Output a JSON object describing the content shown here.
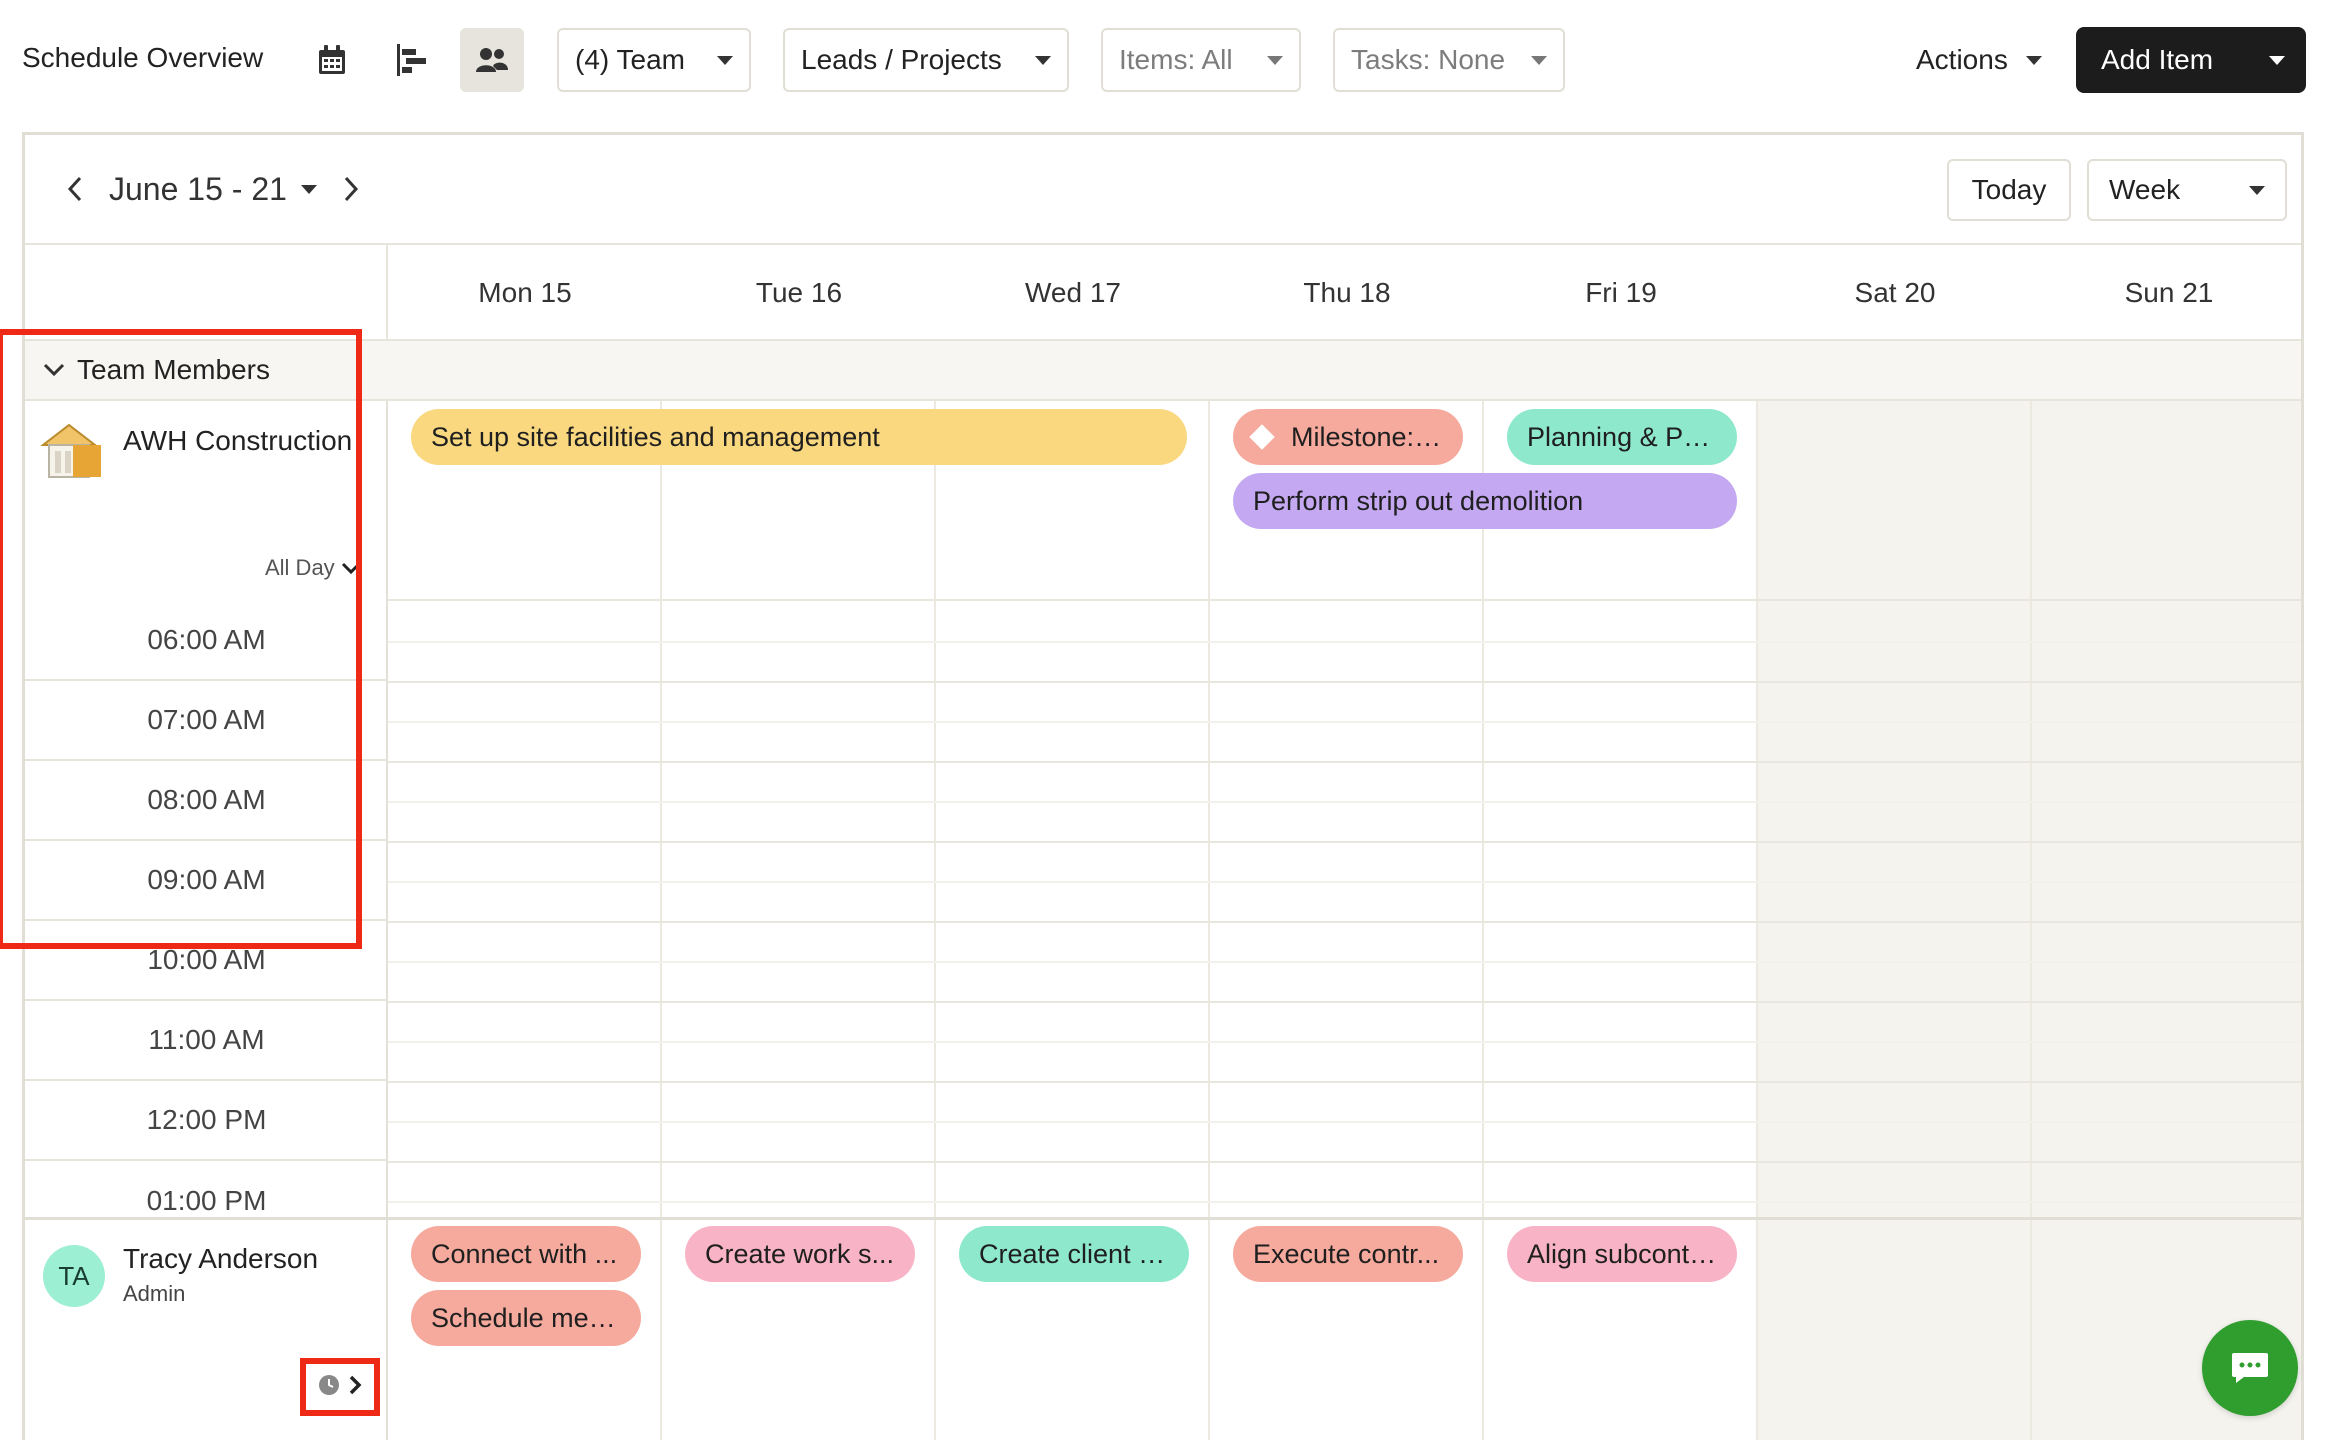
{
  "toolbar": {
    "title": "Schedule Overview",
    "team_filter": "(4) Team",
    "leads_filter": "Leads / Projects",
    "items_filter": "Items: All",
    "tasks_filter": "Tasks: None",
    "actions_label": "Actions",
    "add_item_label": "Add Item"
  },
  "calendar": {
    "range_label": "June 15 - 21",
    "today_label": "Today",
    "view_label": "Week",
    "days": [
      "Mon 15",
      "Tue 16",
      "Wed 17",
      "Thu 18",
      "Fri 19",
      "Sat 20",
      "Sun 21"
    ],
    "group_label": "Team Members"
  },
  "resources": [
    {
      "name": "AWH Construction",
      "allday_label": "All Day",
      "events": [
        {
          "title": "Set up site facilities and management",
          "color": "#fad880"
        },
        {
          "title": "Milestone: ...",
          "color": "#f5aa9d"
        },
        {
          "title": "Planning & Per...",
          "color": "#8ee8cc"
        },
        {
          "title": "Perform strip out demolition",
          "color": "#c4a8f1"
        }
      ],
      "time_slots": [
        "06:00 AM",
        "07:00 AM",
        "08:00 AM",
        "09:00 AM",
        "10:00 AM",
        "11:00 AM",
        "12:00 PM",
        "01:00 PM"
      ]
    },
    {
      "name": "Tracy Anderson",
      "role": "Admin",
      "initials": "TA",
      "events": [
        {
          "title": "Connect with ...",
          "color": "#f5aa9d"
        },
        {
          "title": "Schedule mee...",
          "color": "#f5aa9d"
        },
        {
          "title": "Create work s...",
          "color": "#f8b4c6"
        },
        {
          "title": "Create client p...",
          "color": "#8ee8cc"
        },
        {
          "title": "Execute contr...",
          "color": "#f5aa9d"
        },
        {
          "title": "Align subcontr...",
          "color": "#f8b4c6"
        }
      ]
    }
  ],
  "icons": [
    "calendar-icon",
    "gantt-icon",
    "team-icon",
    "chevron-left-icon",
    "chevron-right-icon",
    "chevron-down-icon",
    "building-icon",
    "clock-icon",
    "chat-icon"
  ],
  "colors": {
    "highlight": "#ee2a16",
    "chat": "#2f9e2f",
    "primary": "#1c1c1c"
  }
}
